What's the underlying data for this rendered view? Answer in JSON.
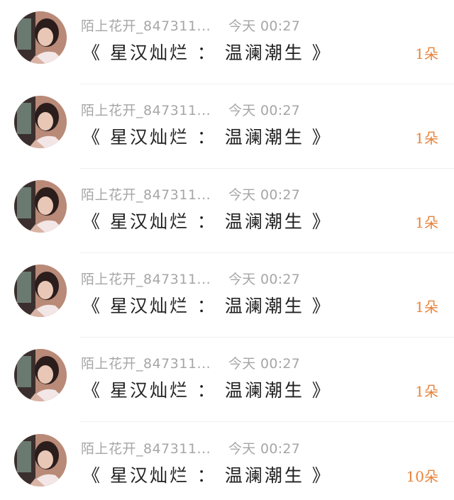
{
  "colors": {
    "meta_text": "#a6a6a6",
    "message_text": "#202020",
    "count_accent": "#e8823a",
    "divider": "#f0f0f0"
  },
  "items": [
    {
      "username": "陌上花开_847311...",
      "time": "今天 00:27",
      "message": "《 星汉灿烂 ： 温澜潮生 》",
      "count": "1朵",
      "avatar_icon": "avatar-photo"
    },
    {
      "username": "陌上花开_847311...",
      "time": "今天 00:27",
      "message": "《 星汉灿烂 ： 温澜潮生 》",
      "count": "1朵",
      "avatar_icon": "avatar-photo"
    },
    {
      "username": "陌上花开_847311...",
      "time": "今天 00:27",
      "message": "《 星汉灿烂 ： 温澜潮生 》",
      "count": "1朵",
      "avatar_icon": "avatar-photo"
    },
    {
      "username": "陌上花开_847311...",
      "time": "今天 00:27",
      "message": "《 星汉灿烂 ： 温澜潮生 》",
      "count": "1朵",
      "avatar_icon": "avatar-photo"
    },
    {
      "username": "陌上花开_847311...",
      "time": "今天 00:27",
      "message": "《 星汉灿烂 ： 温澜潮生 》",
      "count": "1朵",
      "avatar_icon": "avatar-photo"
    },
    {
      "username": "陌上花开_847311...",
      "time": "今天 00:27",
      "message": "《 星汉灿烂 ： 温澜潮生 》",
      "count": "10朵",
      "avatar_icon": "avatar-photo"
    }
  ]
}
